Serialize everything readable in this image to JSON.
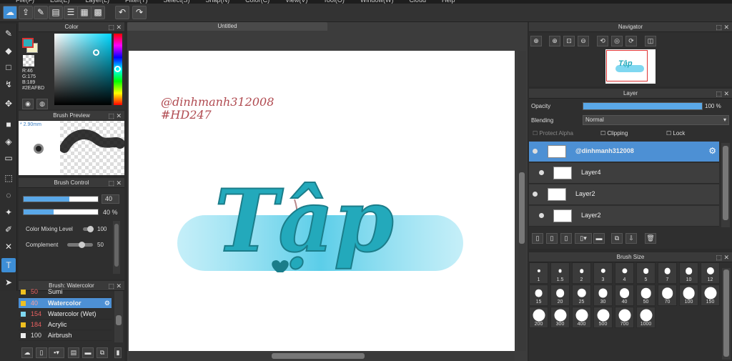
{
  "menu": [
    "File(F)",
    "Edit(E)",
    "Layer(L)",
    "Filter(T)",
    "Select(S)",
    "Snap(N)",
    "Color(C)",
    "View(V)",
    "Tool(O)",
    "Window(W)",
    "Cloud",
    "Help"
  ],
  "document": {
    "tab_title": "Untitled"
  },
  "color_panel": {
    "title": "Color",
    "r": "R:46",
    "g": "G:175",
    "b": "B:189",
    "hex": "#2EAFBD",
    "main_color": "#2eafbd",
    "sub_color": "#f2efc4"
  },
  "brush_preview": {
    "title": "Brush Preview",
    "size": "* 2.90mm"
  },
  "brush_control": {
    "title": "Brush Control",
    "size_value": "40",
    "size_level": 0.62,
    "opacity_value": "40 %",
    "opacity_level": 0.4,
    "color_mixing_label": "Color Mixing Level",
    "color_mixing_value": "100",
    "complement_label": "Complement",
    "complement_value": "50"
  },
  "brush_list": {
    "title": "Brush: Watercolor",
    "items": [
      {
        "num": "50",
        "name": "Sumi",
        "color": "#f0c020"
      },
      {
        "num": "40",
        "name": "Watercolor",
        "color": "#f0c020",
        "selected": true
      },
      {
        "num": "154",
        "name": "Watercolor (Wet)",
        "color": "#7fd7f0"
      },
      {
        "num": "184",
        "name": "Acrylic",
        "color": "#f0c020"
      },
      {
        "num": "100",
        "name": "Airbrush",
        "color": "#eeeeee"
      }
    ]
  },
  "artwork": {
    "handle": "@dinhmanh312008",
    "tag": "#HD247",
    "word": "Tập",
    "accent": "#2eafbd",
    "text_color": "#b04a50"
  },
  "navigator": {
    "title": "Navigator"
  },
  "layer_panel": {
    "title": "Layer",
    "opacity_label": "Opacity",
    "opacity_value": "100 %",
    "opacity_level": 1.0,
    "blending_label": "Blending",
    "blending_value": "Normal",
    "protect_alpha": "Protect Alpha",
    "clipping": "Clipping",
    "lock": "Lock",
    "layers": [
      {
        "name": "@dinhmanh312008",
        "selected": true
      },
      {
        "name": "Layer4"
      },
      {
        "name": "Layer2"
      },
      {
        "name": "Layer2"
      }
    ]
  },
  "brush_size": {
    "title": "Brush Size",
    "sizes": [
      "1",
      "1.5",
      "2",
      "3",
      "4",
      "5",
      "7",
      "10",
      "12",
      "15",
      "20",
      "25",
      "30",
      "40",
      "50",
      "70",
      "100",
      "150",
      "200",
      "300",
      "400",
      "500",
      "700",
      "1000"
    ]
  }
}
